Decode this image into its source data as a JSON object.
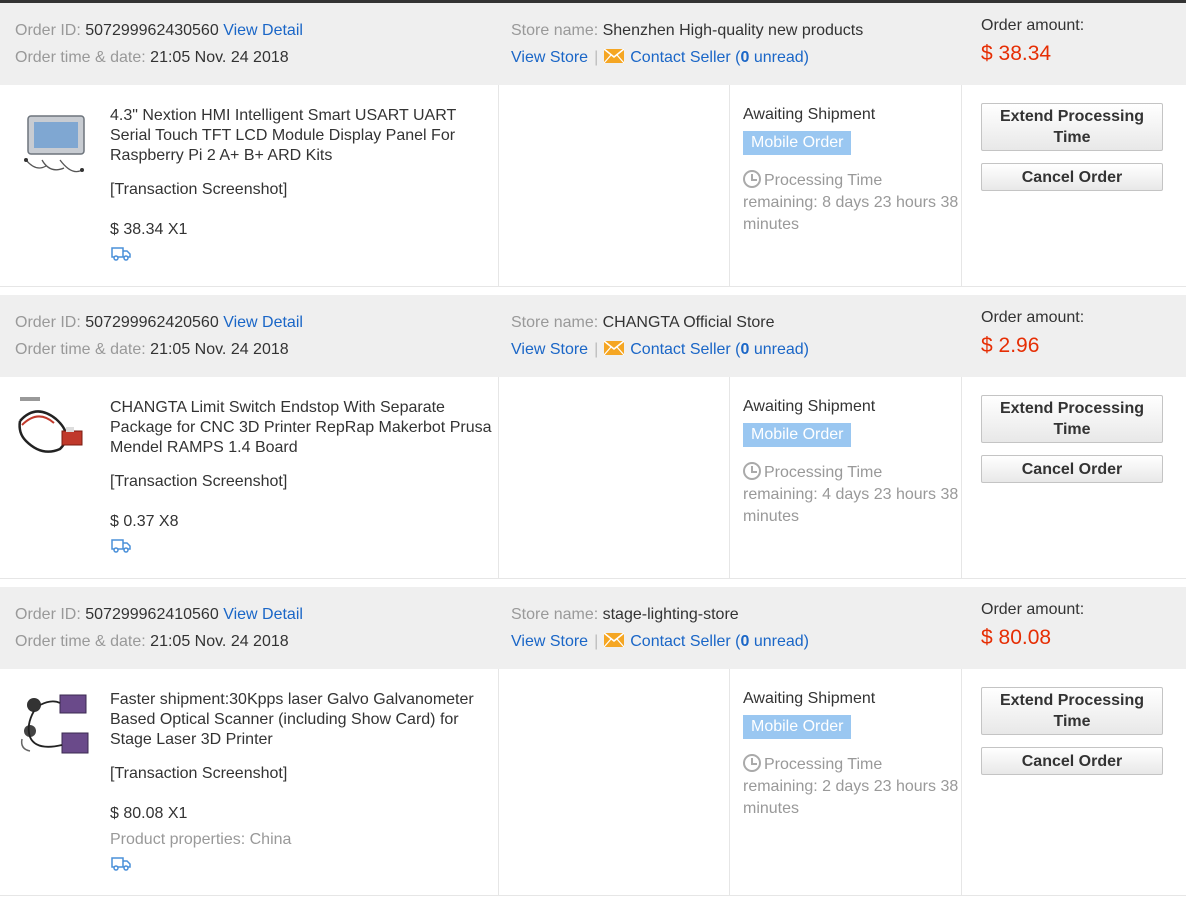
{
  "labels": {
    "order_id": "Order ID:",
    "view_detail": "View Detail",
    "order_time": "Order time & date:",
    "store_name": "Store name:",
    "view_store": "View Store",
    "separator": "|",
    "contact_seller": "Contact Seller (",
    "unread_suffix": " unread)",
    "order_amount": "Order amount:",
    "transaction_screenshot": "[Transaction Screenshot]",
    "extend_processing_time": "Extend Processing Time",
    "cancel_order": "Cancel Order",
    "status": "Awaiting Shipment",
    "badge": "Mobile Order"
  },
  "colors": {
    "link": "#1a66c7",
    "amount": "#e62e04",
    "badge_bg": "#9ac7f1",
    "header_bg": "#efefef",
    "mail_icon": "#f5a623"
  },
  "orders": [
    {
      "order_id": "507299962430560",
      "order_time": "21:05 Nov. 24 2018",
      "store_name": "Shenzhen High-quality new products",
      "unread": "0",
      "amount": "$ 38.34",
      "product_title": "4.3\" Nextion HMI Intelligent Smart USART UART Serial Touch TFT LCD Module Display Panel For Raspberry Pi 2 A+ B+ ARD Kits",
      "price_qty": "$ 38.34 X1",
      "processing_time": "Processing Time remaining: 8 days 23 hours 38 minutes",
      "product_properties": "",
      "thumb_icon": "lcd-display-module-icon"
    },
    {
      "order_id": "507299962420560",
      "order_time": "21:05 Nov. 24 2018",
      "store_name": "CHANGTA Official Store",
      "unread": "0",
      "amount": "$ 2.96",
      "product_title": "CHANGTA Limit Switch Endstop With Separate Package for CNC 3D Printer RepRap Makerbot Prusa Mendel RAMPS 1.4 Board",
      "price_qty": "$ 0.37 X8",
      "processing_time": "Processing Time remaining: 4 days 23 hours 38 minutes",
      "product_properties": "",
      "thumb_icon": "limit-switch-endstop-icon"
    },
    {
      "order_id": "507299962410560",
      "order_time": "21:05 Nov. 24 2018",
      "store_name": "stage-lighting-store",
      "unread": "0",
      "amount": "$ 80.08",
      "product_title": "Faster shipment:30Kpps laser Galvo Galvanometer Based Optical Scanner (including Show Card) for Stage Laser 3D Printer",
      "price_qty": "$ 80.08 X1",
      "processing_time": "Processing Time remaining: 2 days 23 hours 38 minutes",
      "product_properties": "Product properties: China",
      "thumb_icon": "galvo-scanner-icon"
    }
  ]
}
